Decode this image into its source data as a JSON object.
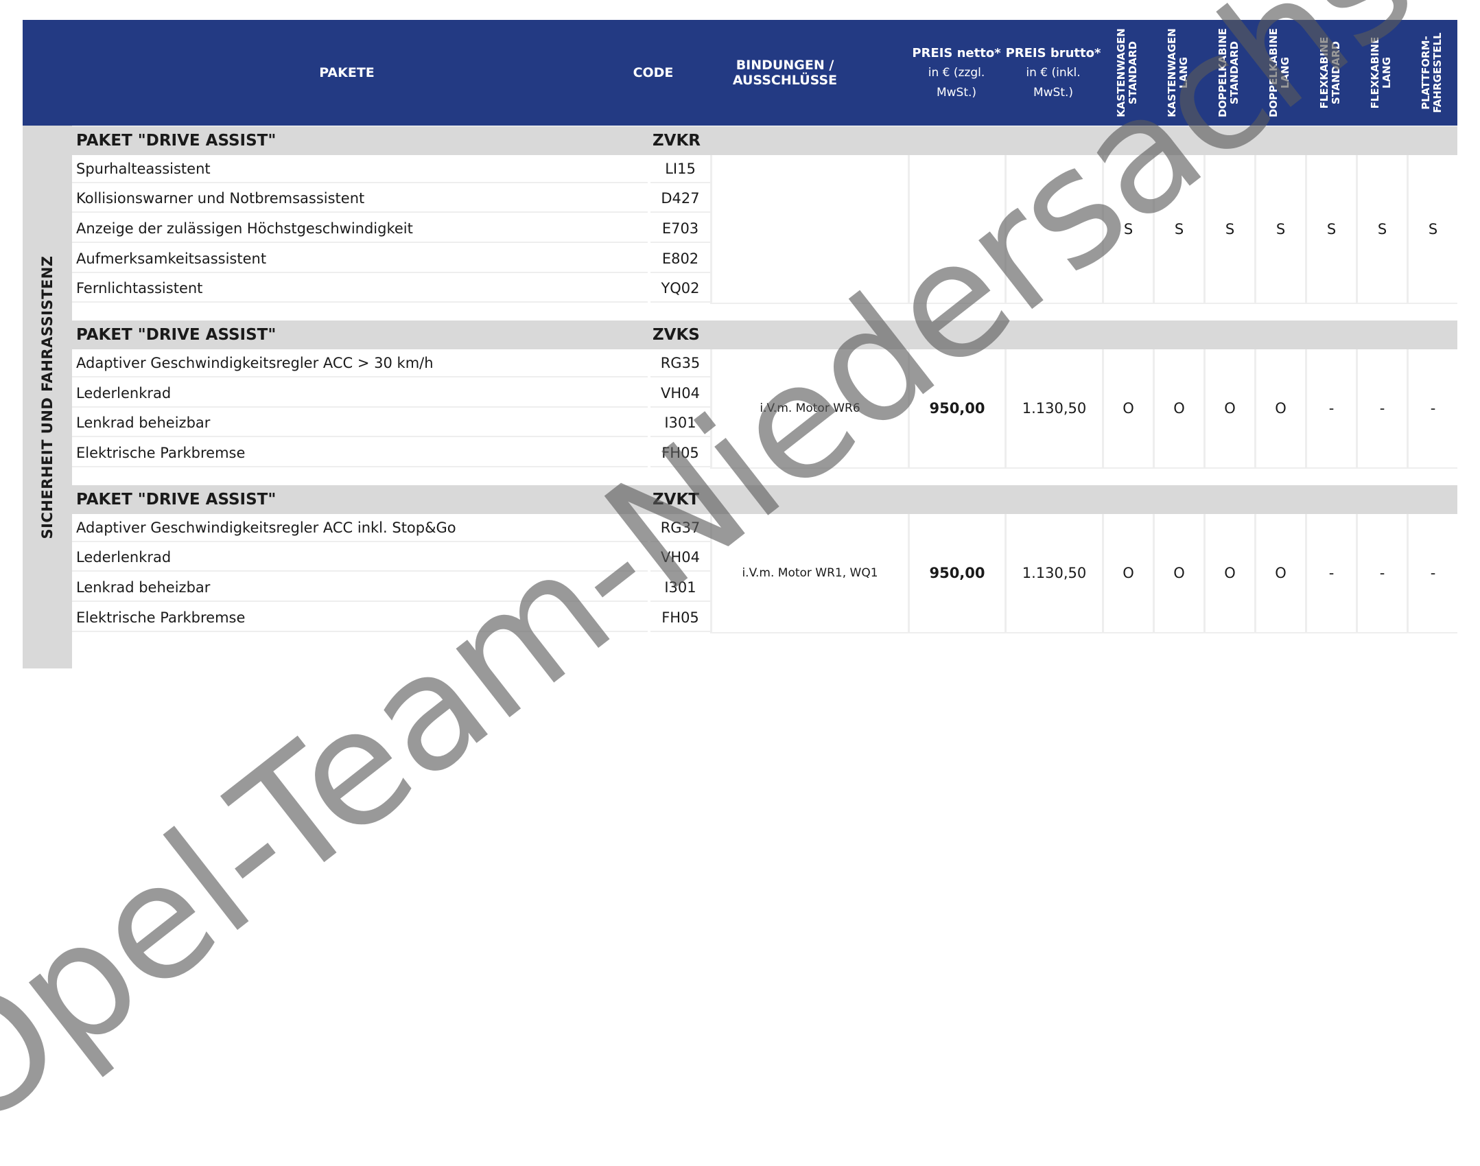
{
  "header": {
    "pakete": "PAKETE",
    "code": "CODE",
    "bindungen": "BINDUNGEN / AUSSCHLÜSSE",
    "preis_netto_title": "PREIS netto*",
    "preis_netto_sub1": "in € (zzgl.",
    "preis_netto_sub2": "MwSt.)",
    "preis_brutto_title": "PREIS brutto*",
    "preis_brutto_sub1": "in € (inkl.",
    "preis_brutto_sub2": "MwSt.)",
    "variants": [
      {
        "l1": "KASTENWAGEN",
        "l2": "STANDARD"
      },
      {
        "l1": "KASTENWAGEN",
        "l2": "LANG"
      },
      {
        "l1": "DOPPELKABINE",
        "l2": "STANDARD"
      },
      {
        "l1": "DOPPELKABINE",
        "l2": "LANG"
      },
      {
        "l1": "FLEXKABINE",
        "l2": "STANDARD"
      },
      {
        "l1": "FLEXKABINE",
        "l2": "LANG"
      },
      {
        "l1": "PLATTFORM-",
        "l2": "FAHRGESTELL"
      }
    ]
  },
  "section_label": "SICHERHEIT UND FAHRASSISTENZ",
  "groups": [
    {
      "title": "PAKET \"DRIVE ASSIST\"",
      "code": "ZVKR",
      "items": [
        {
          "name": "Spurhalteassistent",
          "code": "LI15"
        },
        {
          "name": "Kollisionswarner und Notbremsassistent",
          "code": "D427"
        },
        {
          "name": "Anzeige der zulässigen Höchstgeschwindigkeit",
          "code": "E703"
        },
        {
          "name": "Aufmerksamkeitsassistent",
          "code": "E802"
        },
        {
          "name": "Fernlichtassistent",
          "code": "YQ02"
        }
      ],
      "bindung": "",
      "netto": "",
      "brutto": "",
      "availability": [
        "S",
        "S",
        "S",
        "S",
        "S",
        "S",
        "S"
      ]
    },
    {
      "title": "PAKET \"DRIVE ASSIST\"",
      "code": "ZVKS",
      "items": [
        {
          "name": "Adaptiver Geschwindigkeitsregler ACC > 30 km/h",
          "code": "RG35"
        },
        {
          "name": "Lederlenkrad",
          "code": "VH04"
        },
        {
          "name": "Lenkrad beheizbar",
          "code": "I301"
        },
        {
          "name": "Elektrische Parkbremse",
          "code": "FH05"
        }
      ],
      "bindung": "i.V.m. Motor WR6",
      "netto": "950,00",
      "brutto": "1.130,50",
      "availability": [
        "O",
        "O",
        "O",
        "O",
        "-",
        "-",
        "-"
      ]
    },
    {
      "title": "PAKET \"DRIVE ASSIST\"",
      "code": "ZVKT",
      "items": [
        {
          "name": "Adaptiver Geschwindigkeitsregler ACC inkl. Stop&Go",
          "code": "RG37"
        },
        {
          "name": "Lederlenkrad",
          "code": "VH04"
        },
        {
          "name": "Lenkrad beheizbar",
          "code": "I301"
        },
        {
          "name": "Elektrische Parkbremse",
          "code": "FH05"
        }
      ],
      "bindung": "i.V.m. Motor WR1, WQ1",
      "netto": "950,00",
      "brutto": "1.130,50",
      "availability": [
        "O",
        "O",
        "O",
        "O",
        "-",
        "-",
        "-"
      ]
    }
  ],
  "watermark": "Opel-Team-Niedersachsen",
  "colors": {
    "header_bg": "#233a83",
    "group_bg": "#d9d9d9",
    "grid": "#eeeeee"
  }
}
